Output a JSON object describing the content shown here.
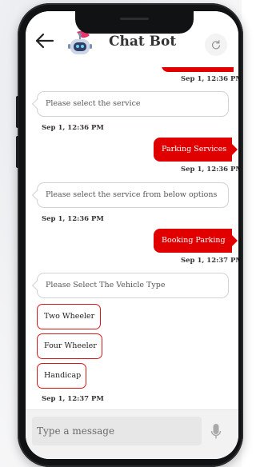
{
  "header": {
    "title": "Chat Bot",
    "back_icon": "arrow-left-icon",
    "avatar_icon": "robot-icon",
    "refresh_icon": "refresh-icon"
  },
  "messages": {
    "top_timestamp": "Sep 1, 12:36 PM",
    "bot_select_service": "Please select the service",
    "bot_select_service_time": "Sep 1, 12:36 PM",
    "user_parking_services": "Parking Services",
    "user_parking_services_time": "Sep 1, 12:36 PM",
    "bot_select_from_options": "Please select the service from below options",
    "bot_select_from_options_time": "Sep 1, 12:36 PM",
    "user_booking_parking": "Booking Parking",
    "user_booking_parking_time": "Sep 1, 12:37 PM",
    "bot_vehicle_type": "Please Select The Vehicle Type",
    "options_time": "Sep 1, 12:37 PM"
  },
  "vehicle_options": [
    "Two Wheeler",
    "Four Wheeler",
    "Handicap"
  ],
  "input": {
    "placeholder": "Type a message",
    "mic_icon": "microphone-icon"
  },
  "colors": {
    "accent": "#e00000",
    "option_border": "#d81818",
    "bot_border": "#cfd3d8"
  }
}
